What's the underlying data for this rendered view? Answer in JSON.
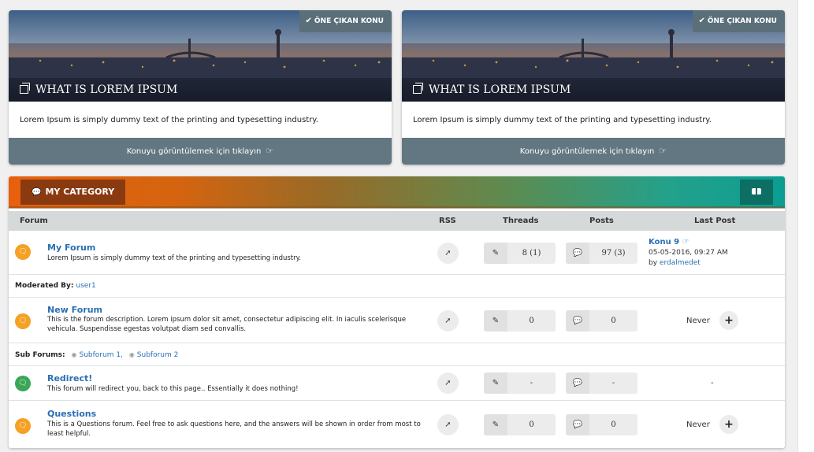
{
  "featured": [
    {
      "badge": "ÖNE ÇIKAN KONU",
      "title": "WHAT IS LOREM IPSUM",
      "text": "Lorem Ipsum is simply dummy text of the printing and typesetting industry.",
      "footer": "Konuyu görüntülemek için tıklayın"
    },
    {
      "badge": "ÖNE ÇIKAN KONU",
      "title": "WHAT IS LOREM IPSUM",
      "text": "Lorem Ipsum is simply dummy text of the printing and typesetting industry.",
      "footer": "Konuyu görüntülemek için tıklayın"
    }
  ],
  "category": {
    "title": "MY CATEGORY",
    "columns": {
      "forum": "Forum",
      "rss": "RSS",
      "threads": "Threads",
      "posts": "Posts",
      "last_post": "Last Post"
    },
    "forums": [
      {
        "name": "My Forum",
        "description": "Lorem Ipsum is simply dummy text of the printing and typesetting industry.",
        "threads": "8 (1)",
        "posts": "97 (3)",
        "last_post": {
          "title": "Konu 9",
          "date": "05-05-2016, 09:27 AM",
          "by_label": "by",
          "by": "erdalmedet"
        },
        "icon_color": "orange"
      },
      {
        "name": "New Forum",
        "description": "This is the forum description. Lorem ipsum dolor sit amet, consectetur adipiscing elit. In iaculis scelerisque vehicula. Suspendisse egestas volutpat diam sed convallis.",
        "threads": "0",
        "posts": "0",
        "last_post_text": "Never",
        "icon_color": "orange"
      },
      {
        "name": "Redirect!",
        "description": "This forum will redirect you, back to this page.. Essentially it does nothing!",
        "threads": "-",
        "posts": "-",
        "last_post_text": "-",
        "icon_color": "green"
      },
      {
        "name": "Questions",
        "description": "This is a Questions forum. Feel free to ask questions here, and the answers will be shown in order from most to least helpful.",
        "threads": "0",
        "posts": "0",
        "last_post_text": "Never",
        "icon_color": "orange"
      }
    ],
    "moderated": {
      "label": "Moderated By:",
      "user": "user1"
    },
    "subforums": {
      "label": "Sub Forums:",
      "items": [
        "Subforum 1,",
        "Subforum 2"
      ]
    }
  },
  "colors": {
    "accent_orange": "#f4a125",
    "accent_green": "#3aa756",
    "link": "#2a6fb4",
    "footer_bar": "#627781"
  }
}
